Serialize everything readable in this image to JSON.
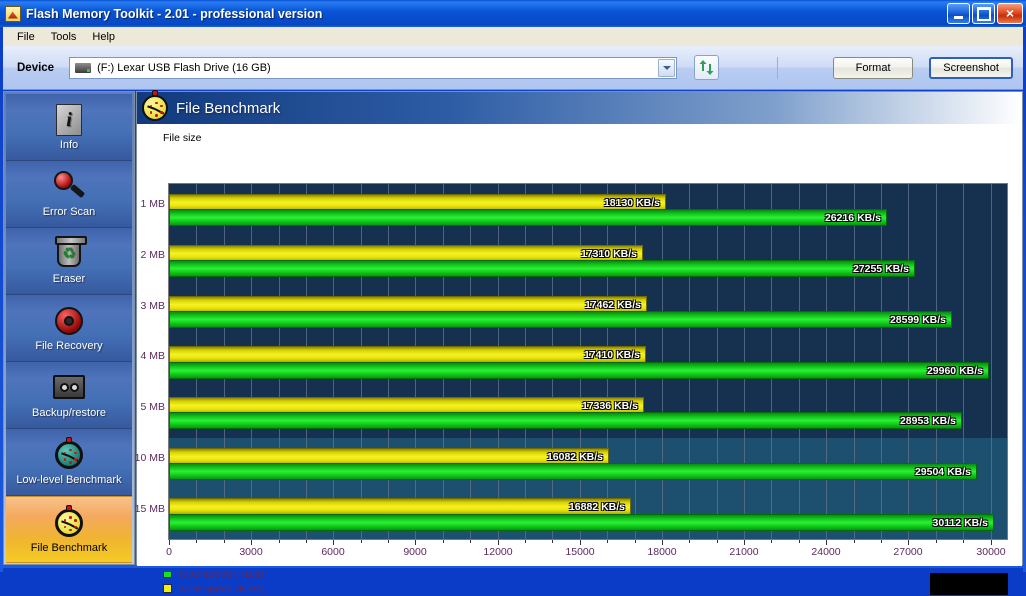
{
  "window": {
    "title": "Flash Memory Toolkit - 2.01 - professional version",
    "icon": "flash-drive-icon",
    "minimize_label": "",
    "maximize_label": "",
    "close_label": "×"
  },
  "menubar": {
    "items": [
      {
        "label": "File"
      },
      {
        "label": "Tools"
      },
      {
        "label": "Help"
      }
    ]
  },
  "toolbar": {
    "device_label": "Device",
    "device_value": "(F:) Lexar   USB Flash Drive (16 GB)",
    "device_icon": "usb-drive-icon",
    "refresh_icon": "refresh-arrows-icon",
    "format_label": "Format",
    "screenshot_label": "Screenshot"
  },
  "sidebar": {
    "items": [
      {
        "label": "Info",
        "icon": "info-document-icon",
        "active": false
      },
      {
        "label": "Error Scan",
        "icon": "magnifier-icon",
        "active": false
      },
      {
        "label": "Eraser",
        "icon": "recycle-bin-icon",
        "active": false
      },
      {
        "label": "File Recovery",
        "icon": "lifebuoy-ring-icon",
        "active": false
      },
      {
        "label": "Backup/restore",
        "icon": "cassette-tape-icon",
        "active": false
      },
      {
        "label": "Low-level Benchmark",
        "icon": "stopwatch-teal-icon",
        "active": false
      },
      {
        "label": "File Benchmark",
        "icon": "stopwatch-yellow-icon",
        "active": true
      }
    ]
  },
  "panel": {
    "title": "File Benchmark",
    "icon": "stopwatch-yellow-icon"
  },
  "chart_data": {
    "type": "bar",
    "title": "",
    "ylabel": "File size",
    "xlabel": "",
    "orientation": "horizontal",
    "categories": [
      "1 MB",
      "2 MB",
      "3 MB",
      "4 MB",
      "5 MB",
      "10 MB",
      "15 MB"
    ],
    "series": [
      {
        "name": "write speed (KB/s)",
        "color": "#f2ed18",
        "values": [
          18130,
          17310,
          17462,
          17410,
          17336,
          16082,
          16882
        ],
        "labels": [
          "18130 KB/s",
          "17310 KB/s",
          "17462 KB/s",
          "17410 KB/s",
          "17336 KB/s",
          "16082 KB/s",
          "16882 KB/s"
        ]
      },
      {
        "name": "read speed (KB/s)",
        "color": "#1de01d",
        "values": [
          26216,
          27255,
          28599,
          29960,
          28953,
          29504,
          30112
        ],
        "labels": [
          "26216 KB/s",
          "27255 KB/s",
          "28599 KB/s",
          "29960 KB/s",
          "28953 KB/s",
          "29504 KB/s",
          "30112 KB/s"
        ]
      }
    ],
    "xlim": [
      0,
      30600
    ],
    "xticks": [
      0,
      3000,
      6000,
      9000,
      12000,
      15000,
      18000,
      21000,
      24000,
      27000,
      30000
    ],
    "xtick_labels": [
      "0",
      "3000",
      "6000",
      "9000",
      "12000",
      "15000",
      "18000",
      "21000",
      "24000",
      "27000",
      "30000"
    ],
    "grid": true,
    "legend_position": "bottom-left",
    "legend": [
      {
        "label": "read speed (KB/s)",
        "color": "#1de01d"
      },
      {
        "label": "write speed (KB/s)",
        "color": "#f2ed18"
      }
    ],
    "plot_background": "#16304f"
  }
}
